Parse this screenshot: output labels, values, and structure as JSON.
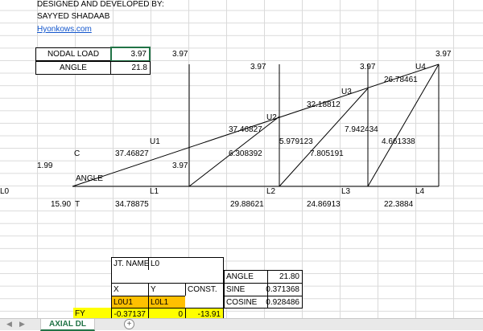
{
  "header": {
    "designed_by": "DESIGNED AND DEVELOPED BY:",
    "author": "SAYYED SHADAAB",
    "website": "Hyonkows.com"
  },
  "inputs": {
    "nodal_load_label": "NODAL LOAD",
    "nodal_load_value": "3.97",
    "angle_label": "ANGLE",
    "angle_value": "21.8"
  },
  "truss": {
    "top_loads": [
      "3.97",
      "3.97",
      "3.97",
      "3.97"
    ],
    "left_load": "3.97",
    "support_reaction": "1.99",
    "c_label": "C",
    "t_label": "T",
    "angle_label": "ANGLE",
    "top_node_labels": [
      "U1",
      "U2",
      "U3",
      "U4"
    ],
    "bottom_node_labels": [
      "L0",
      "L1",
      "L2",
      "L3",
      "L4"
    ],
    "top_chord_forces": [
      "37.46827",
      "37.46827",
      "32.18812",
      "26.78461"
    ],
    "diagonal_forces": [
      "6.308392",
      "7.805191",
      "7.942434",
      "4.661338"
    ],
    "vertical_forces": [
      "5.979123"
    ],
    "bottom_chord_forces": [
      "15.90",
      "34.78875",
      "29.88621",
      "24.86913",
      "22.3884"
    ]
  },
  "calc_table": {
    "jt_name_label": "JT. NAME",
    "jt_name_value": "L0",
    "x_label": "X",
    "y_label": "Y",
    "const_label": "CONST.",
    "x_member": "L0U1",
    "y_member": "L0L1",
    "fy_label": "FY",
    "fy_x": "-0.37137",
    "fy_y": "0",
    "fy_const": "-13.91"
  },
  "trig_table": {
    "angle_label": "ANGLE",
    "angle_value": "21.80",
    "sine_label": "SINE",
    "sine_value": "0.371368",
    "cosine_label": "COSINE",
    "cosine_value": "0.928486"
  },
  "sheet_tabs": [
    "AXIAL DL"
  ],
  "colors": {
    "yellow_fill": "#ffff00",
    "orange_fill": "#ffc000",
    "selected_border": "#217346",
    "gridline": "#dadada"
  }
}
